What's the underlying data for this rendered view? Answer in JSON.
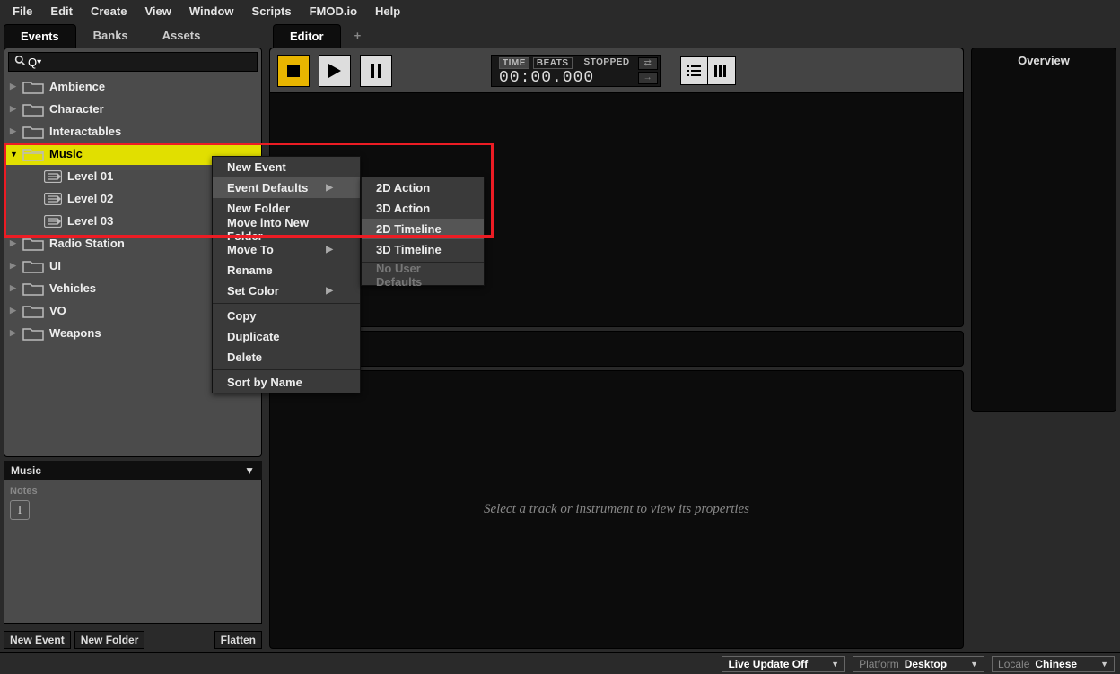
{
  "menubar": [
    "File",
    "Edit",
    "Create",
    "View",
    "Window",
    "Scripts",
    "FMOD.io",
    "Help"
  ],
  "left_tabs": [
    {
      "label": "Events",
      "active": true
    },
    {
      "label": "Banks",
      "active": false
    },
    {
      "label": "Assets",
      "active": false
    }
  ],
  "search": {
    "prefix": "Q",
    "caret": "▾"
  },
  "tree": [
    {
      "type": "folder",
      "label": "Ambience",
      "expanded": false
    },
    {
      "type": "folder",
      "label": "Character",
      "expanded": false
    },
    {
      "type": "folder",
      "label": "Interactables",
      "expanded": false
    },
    {
      "type": "folder",
      "label": "Music",
      "expanded": true,
      "selected": true,
      "children": [
        {
          "type": "event",
          "label": "Level 01"
        },
        {
          "type": "event",
          "label": "Level 02"
        },
        {
          "type": "event",
          "label": "Level 03"
        }
      ]
    },
    {
      "type": "folder",
      "label": "Radio Station",
      "expanded": false
    },
    {
      "type": "folder",
      "label": "UI",
      "expanded": false
    },
    {
      "type": "folder",
      "label": "Vehicles",
      "expanded": false
    },
    {
      "type": "folder",
      "label": "VO",
      "expanded": false
    },
    {
      "type": "folder",
      "label": "Weapons",
      "expanded": false
    }
  ],
  "context_menu": {
    "items": [
      {
        "label": "New Event"
      },
      {
        "label": "Event Defaults",
        "submenu": true,
        "hover": true
      },
      {
        "label": "New Folder"
      },
      {
        "label": "Move into New Folder"
      },
      {
        "label": "Move To",
        "submenu": true
      },
      {
        "label": "Rename"
      },
      {
        "label": "Set Color",
        "submenu": true
      },
      {
        "sep": true
      },
      {
        "label": "Copy"
      },
      {
        "label": "Duplicate"
      },
      {
        "label": "Delete"
      },
      {
        "sep": true
      },
      {
        "label": "Sort by Name"
      }
    ],
    "submenu": [
      {
        "label": "2D Action"
      },
      {
        "label": "3D Action"
      },
      {
        "label": "2D Timeline",
        "hover": true
      },
      {
        "label": "3D Timeline"
      },
      {
        "sep": true
      },
      {
        "label": "No User Defaults",
        "disabled": true
      }
    ]
  },
  "panel": {
    "title": "Music",
    "caret": "▼"
  },
  "notes": {
    "label": "Notes",
    "cursor": "I"
  },
  "left_actions": {
    "new_event": "New Event",
    "new_folder": "New Folder",
    "flatten": "Flatten"
  },
  "editor_tab": "Editor",
  "editor_plus": "+",
  "transport": {
    "labels": {
      "time": "TIME",
      "beats": "BEATS",
      "status": "STOPPED"
    },
    "time": "00:00.000"
  },
  "overview": "Overview",
  "inspector_placeholder": "Select a track or instrument to view its properties",
  "status": {
    "live_update": "Live Update Off",
    "platform_lbl": "Platform",
    "platform_val": "Desktop",
    "locale_lbl": "Locale",
    "locale_val": "Chinese"
  }
}
